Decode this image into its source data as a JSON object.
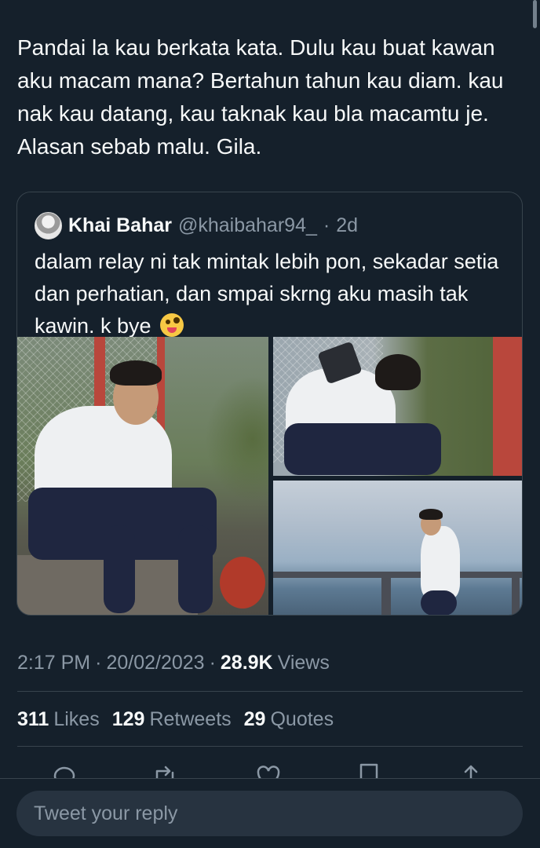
{
  "tweet": {
    "text": "Pandai la kau berkata kata. Dulu kau buat kawan aku macam mana? Bertahun tahun kau diam. kau nak kau datang, kau taknak kau bla macamtu je. Alasan sebab malu. Gila."
  },
  "quoted": {
    "name": "Khai Bahar",
    "handle": "@khaibahar94_",
    "separator": "·",
    "time": "2d",
    "text": "dalam relay ni tak mintak lebih pon, sekadar setia dan perhatian, dan smpai skrng aku masih tak kawin. k bye",
    "emoji_icon": "zany-face-emoji"
  },
  "meta": {
    "time": "2:17 PM",
    "sep1": "·",
    "date": "20/02/2023",
    "sep2": "·",
    "views_count": "28.9K",
    "views_label": "Views"
  },
  "stats": {
    "likes_count": "311",
    "likes_label": "Likes",
    "retweets_count": "129",
    "retweets_label": "Retweets",
    "quotes_count": "29",
    "quotes_label": "Quotes"
  },
  "actions": [
    "reply-icon",
    "retweet-icon",
    "like-icon",
    "bookmark-icon",
    "share-icon"
  ],
  "reply": {
    "placeholder": "Tweet your reply"
  },
  "colors": {
    "background": "#15202b",
    "text": "#f7f9f9",
    "secondary": "#8b98a5",
    "border": "#38444d"
  }
}
